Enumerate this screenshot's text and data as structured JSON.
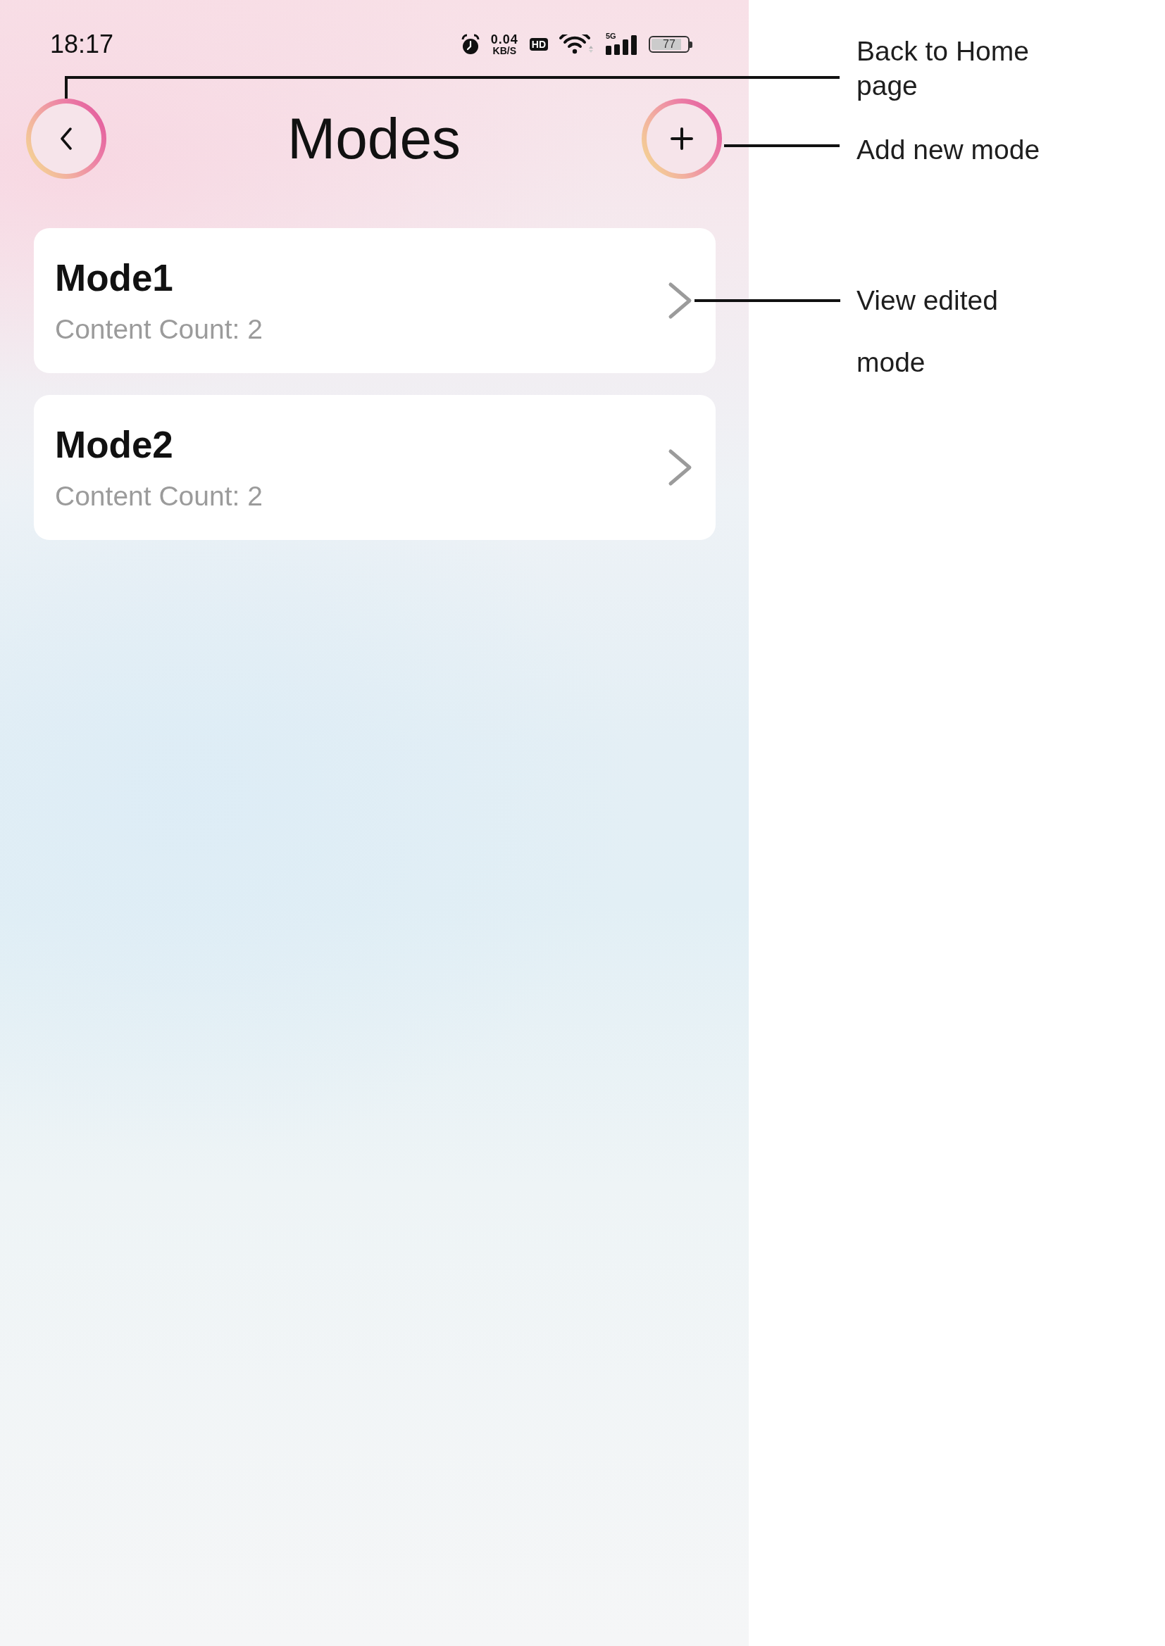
{
  "status_bar": {
    "time": "18:17",
    "net_speed": "0.04",
    "net_speed_unit": "KB/S",
    "hd_label": "HD",
    "network_type": "5G",
    "battery": "77"
  },
  "header": {
    "title": "Modes"
  },
  "modes": [
    {
      "name": "Mode1",
      "content_count": "Content Count: 2"
    },
    {
      "name": "Mode2",
      "content_count": "Content Count: 2"
    }
  ],
  "annotations": [
    {
      "kind": "back",
      "text": "Back to Home page"
    },
    {
      "kind": "add",
      "text": "Add new mode"
    },
    {
      "kind": "view",
      "text": "View edited mode"
    }
  ]
}
